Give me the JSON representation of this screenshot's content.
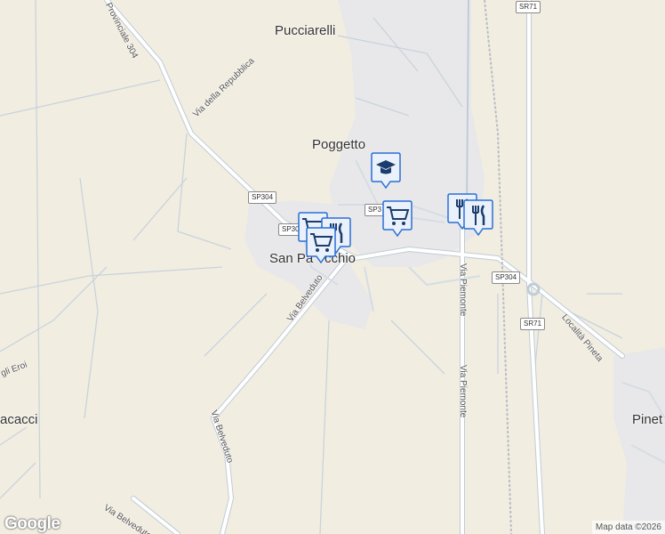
{
  "map": {
    "towns": [
      "Pucciarelli",
      "Poggetto",
      "San Pa",
      "cchio",
      "Pinet",
      "acacci"
    ],
    "roads": [
      "Provinciale 304",
      "Via della Repubblica",
      "Via Belveduto",
      "Via Belveduto",
      "Via Belveduto",
      "Via Piemonte",
      "Via Piemonte",
      "Località Pineta",
      "gli Eroi"
    ],
    "shields": [
      "SR71",
      "SP304",
      "SP30",
      "SP3",
      "SP304",
      "SR71"
    ],
    "markers": [
      {
        "type": "school",
        "icon": "graduation-cap-icon"
      },
      {
        "type": "shopping",
        "icon": "shopping-cart-icon"
      },
      {
        "type": "restaurant",
        "icon": "fork-knife-icon"
      },
      {
        "type": "restaurant",
        "icon": "fork-knife-icon"
      },
      {
        "type": "shopping",
        "icon": "shopping-cart-icon"
      },
      {
        "type": "restaurant",
        "icon": "fork-knife-icon"
      },
      {
        "type": "shopping",
        "icon": "shopping-cart-icon"
      }
    ],
    "colors": {
      "land": "#f1ede1",
      "road": "#ffffff",
      "road_edge": "#c9d3dc",
      "marker": "#2a6fd6"
    }
  },
  "footer": {
    "logo": "Google",
    "attribution": "Map data ©2026"
  }
}
